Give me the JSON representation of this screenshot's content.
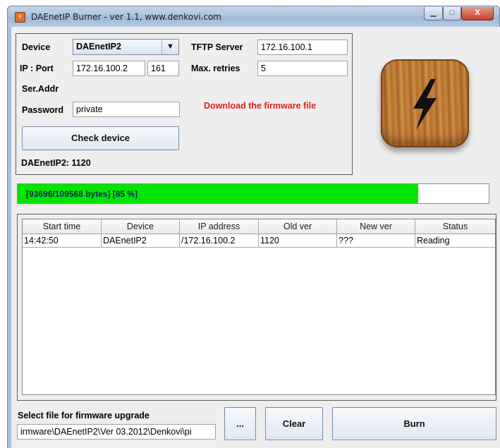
{
  "window": {
    "title": "DAEnetIP Burner - ver 1.1, www.denkovi.com",
    "minimize_symbol": "▁",
    "maximize_symbol": "□",
    "close_symbol": "X"
  },
  "device_panel": {
    "device_label": "Device",
    "device_value": "DAEnetIP2",
    "ip_port_label": "IP : Port",
    "ip_value": "172.16.100.2",
    "port_value": "161",
    "ser_addr_label": "Ser.Addr",
    "password_label": "Password",
    "password_value": "private",
    "tftp_label": "TFTP Server",
    "tftp_value": "172.16.100.1",
    "retries_label": "Max. retries",
    "retries_value": "5",
    "download_link": "Download the firmware file",
    "check_button": "Check device",
    "device_status": "DAEnetIP2: 1120"
  },
  "logo_icon": "lightning-bolt-icon",
  "progress": {
    "text": "[93696/109568 bytes] [85 %]",
    "fraction": 0.85,
    "color": "#00e600"
  },
  "table": {
    "columns": [
      "Start time",
      "Device",
      "IP address",
      "Old ver",
      "New ver",
      "Status"
    ],
    "rows": [
      [
        "14:42:50",
        "DAEnetIP2",
        "/172.16.100.2",
        "1120",
        "???",
        "Reading"
      ]
    ]
  },
  "footer": {
    "select_label": "Select file for firmware upgrade",
    "file_path": "irmware\\DAEnetIP2\\Ver 03.2012\\Denkovi\\pi",
    "browse_button": "...",
    "clear_button": "Clear",
    "burn_button": "Burn"
  }
}
